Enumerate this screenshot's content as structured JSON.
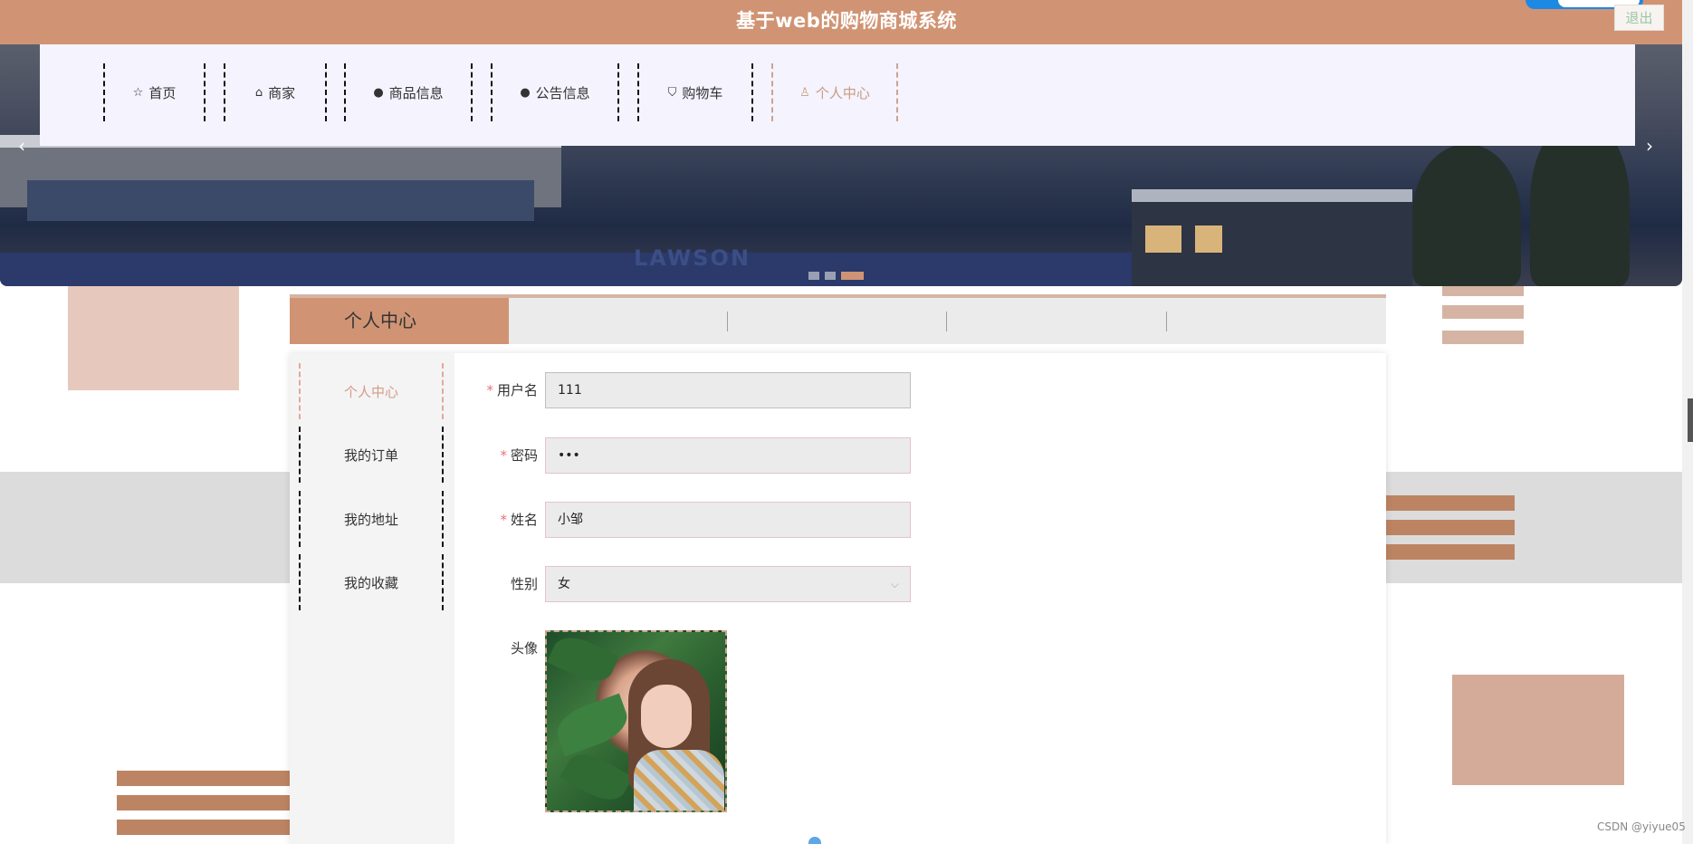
{
  "header": {
    "site_title": "基于web的购物商城系统",
    "logout_label": "退出"
  },
  "nav": {
    "items": [
      {
        "label": "首页",
        "icon": "star-icon"
      },
      {
        "label": "商家",
        "icon": "bag-icon"
      },
      {
        "label": "商品信息",
        "icon": "exclamation-circle-icon"
      },
      {
        "label": "公告信息",
        "icon": "question-circle-icon"
      },
      {
        "label": "购物车",
        "icon": "cart-icon"
      },
      {
        "label": "个人中心",
        "icon": "user-icon",
        "active": true
      }
    ]
  },
  "banner": {
    "sign_text": "LAWSON",
    "slide_count": 3,
    "active_slide": 3
  },
  "section": {
    "title": "个人中心"
  },
  "sidebar": {
    "items": [
      {
        "label": "个人中心",
        "active": true
      },
      {
        "label": "我的订单"
      },
      {
        "label": "我的地址"
      },
      {
        "label": "我的收藏"
      }
    ]
  },
  "form": {
    "username": {
      "label": "用户名",
      "required": true,
      "value": "111"
    },
    "password": {
      "label": "密码",
      "required": true,
      "value": "•••"
    },
    "name": {
      "label": "姓名",
      "required": true,
      "value": "小邹"
    },
    "gender": {
      "label": "性别",
      "value": "女"
    },
    "avatar": {
      "label": "头像"
    }
  },
  "footer": {
    "credit": "CSDN @yiyue05"
  },
  "colors": {
    "brand": "#d09474",
    "nav_bg": "#f5f3fe",
    "required": "#e8727a",
    "active_text": "#c79b82"
  }
}
